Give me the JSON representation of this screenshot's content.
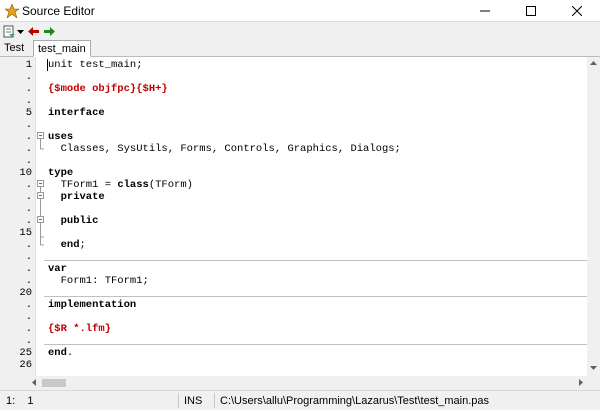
{
  "window": {
    "title": "Source Editor"
  },
  "toolbar": {
    "icons": [
      "jump-list-icon",
      "dropdown-icon",
      "back-arrow-icon",
      "forward-arrow-icon"
    ]
  },
  "tabs": [
    {
      "label": "Test",
      "active": false
    },
    {
      "label": "test_main",
      "active": true
    }
  ],
  "gutter": {
    "markers": [
      "1",
      ".",
      ".",
      ".",
      "5",
      ".",
      ".",
      ".",
      ".",
      "10",
      ".",
      ".",
      ".",
      ".",
      "15",
      ".",
      ".",
      ".",
      ".",
      "20",
      ".",
      ".",
      ".",
      ".",
      "25",
      "26"
    ]
  },
  "code": {
    "line1": "unit test_main;",
    "line3": "{$mode objfpc}{$H+}",
    "line5": "interface",
    "line7": "uses",
    "line8": "  Classes, SysUtils, Forms, Controls, Graphics, Dialogs;",
    "line10": "type",
    "line11a": "  TForm1 = ",
    "line11b": "class",
    "line11c": "(TForm)",
    "line12": "  private",
    "line14": "  public",
    "line16a": "  ",
    "line16b": "end",
    "line16c": ";",
    "line18": "var",
    "line19": "  Form1: TForm1;",
    "line21": "implementation",
    "line23": "{$R *.lfm}",
    "line25a": "end",
    "line25b": "."
  },
  "status": {
    "position": "1:    1",
    "mode": "INS",
    "file_path": "C:\\Users\\allu\\Programming\\Lazarus\\Test\\test_main.pas"
  },
  "colors": {
    "directive": "#c00000",
    "titlebar": "#ffffff",
    "statusbar": "#f0f0f0"
  }
}
